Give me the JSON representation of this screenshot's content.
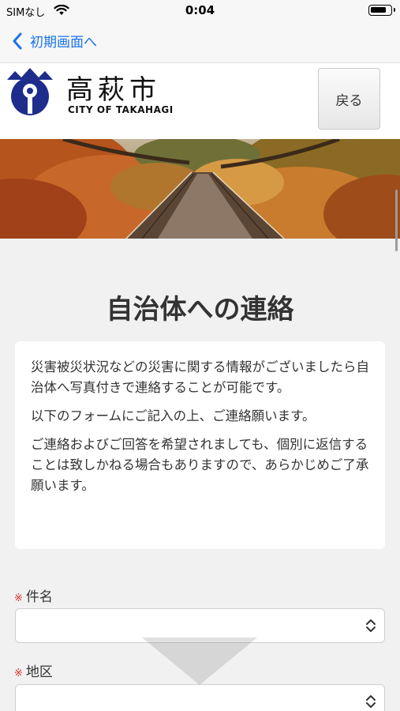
{
  "status_bar": {
    "carrier": "SIMなし",
    "time": "0:04"
  },
  "nav": {
    "back_label": "初期画面へ"
  },
  "header": {
    "city_name": "高萩市",
    "city_name_en": "CITY OF TAKAHAGI",
    "back_button": "戻る"
  },
  "page": {
    "title": "自治体への連絡",
    "paragraphs": [
      "災害被災状況などの災害に関する情報がございましたら自治体へ写真付きで連絡することが可能です。",
      "以下のフォームにご記入の上、ご連絡願います。",
      "ご連絡およびご回答を希望されましても、個別に返信することは致しかねる場合もありますので、あらかじめご了承願います。"
    ]
  },
  "form": {
    "required_mark": "※",
    "fields": [
      {
        "label": "件名",
        "value": ""
      },
      {
        "label": "地区",
        "value": ""
      }
    ]
  },
  "colors": {
    "link": "#1a73e8",
    "required": "#d9302c",
    "emblem": "#1e2d8c"
  }
}
